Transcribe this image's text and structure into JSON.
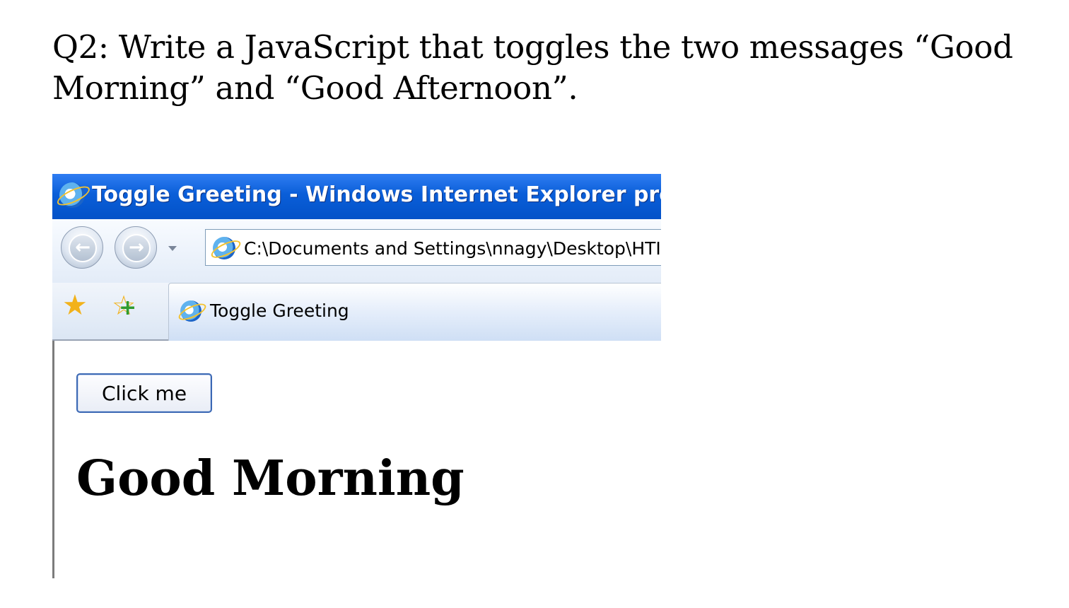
{
  "question": "Q2: Write a JavaScript that toggles the two messages “Good Morning” and “Good Afternoon”.",
  "window": {
    "title": "Toggle Greeting - Windows Internet Explorer provi"
  },
  "address_bar": {
    "value": "C:\\Documents and Settings\\nnagy\\Desktop\\HTI"
  },
  "tab": {
    "label": "Toggle Greeting"
  },
  "page": {
    "button_label": "Click me",
    "greeting": "Good Morning"
  },
  "icons": {
    "browser": "ie-logo-icon",
    "back": "back-arrow-icon",
    "forward": "forward-arrow-icon",
    "favorites": "favorites-star-icon",
    "add_favorite": "add-favorite-icon"
  },
  "colors": {
    "titlebar": "#0a5ed8",
    "button_border": "#3b68b4"
  }
}
